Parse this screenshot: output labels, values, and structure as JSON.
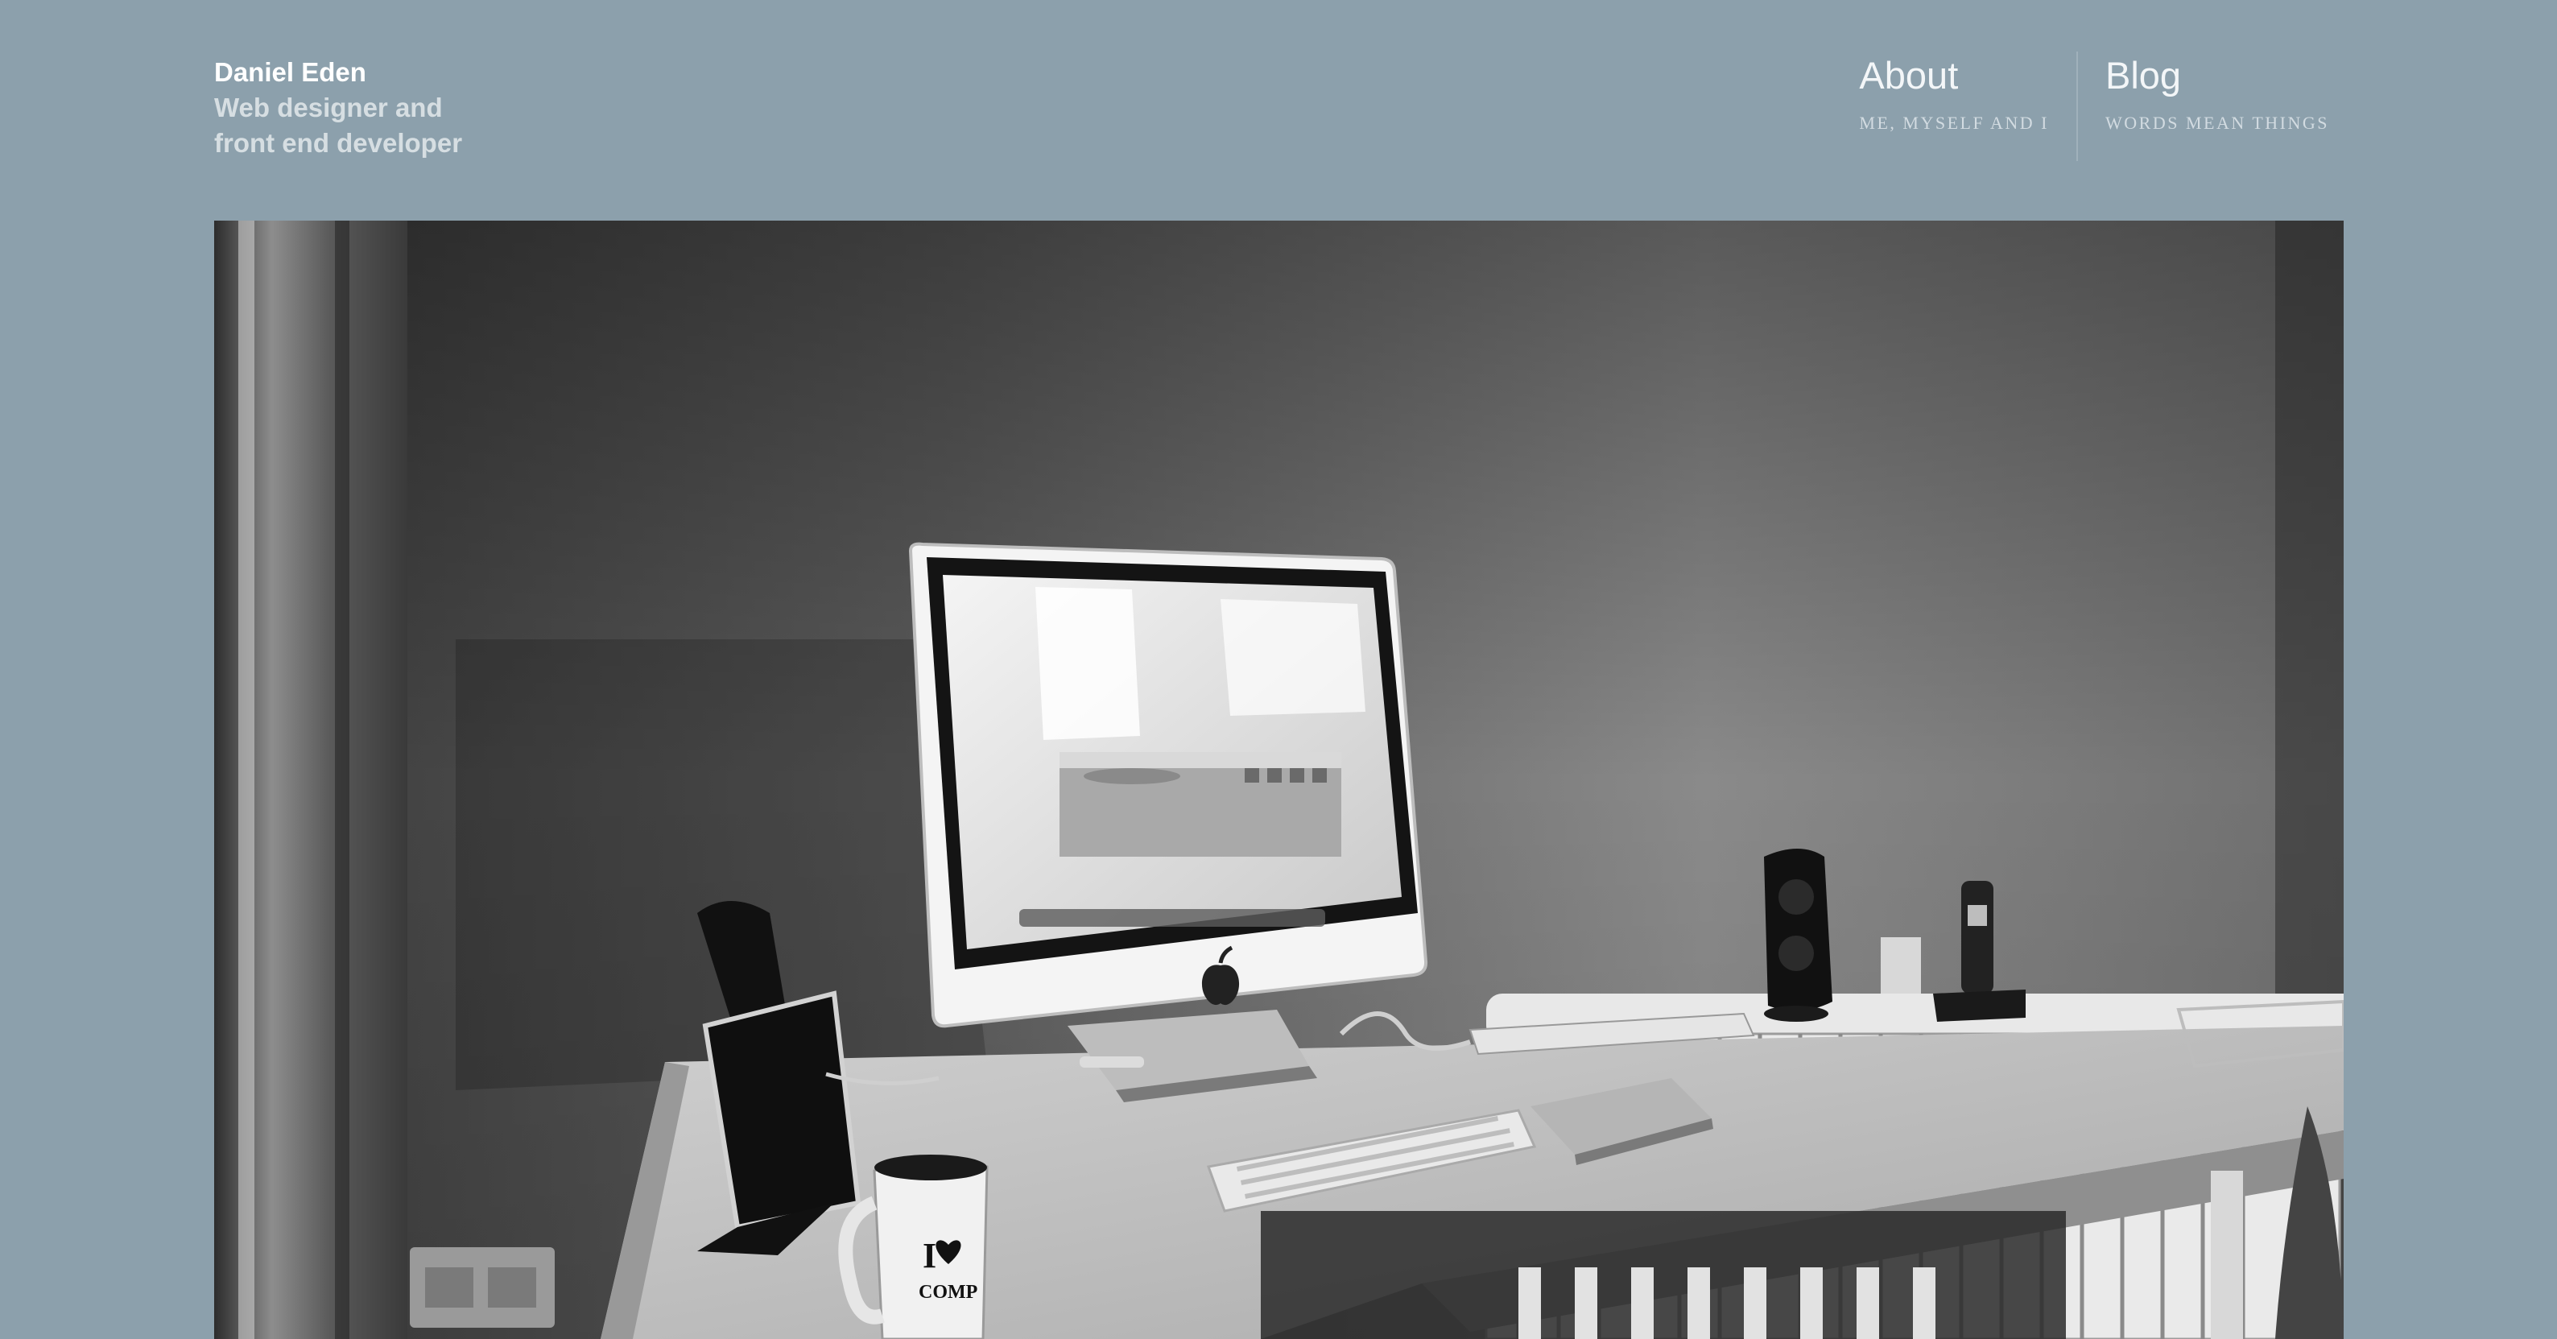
{
  "site": {
    "name": "Daniel Eden",
    "tagline_line1": "Web designer and",
    "tagline_line2": "front end developer"
  },
  "nav": {
    "items": [
      {
        "title": "About",
        "subtitle": "ME, MYSELF AND I"
      },
      {
        "title": "Blog",
        "subtitle": "WORDS MEAN THINGS"
      }
    ]
  },
  "hero": {
    "mug_text_line1": "I",
    "mug_text_line2": "COMP",
    "icon": "desk-photo"
  },
  "colors": {
    "background": "#8ca0ac",
    "text_primary": "#ffffff",
    "text_muted": "#d2dbe1"
  }
}
